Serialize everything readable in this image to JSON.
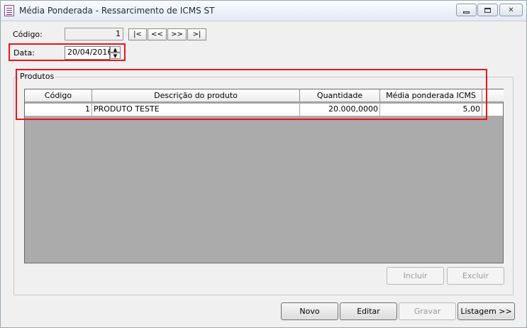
{
  "window": {
    "title": "Média Ponderada - Ressarcimento de ICMS ST",
    "icons": {
      "app": "form-icon",
      "minimize": "minimize-icon",
      "maximize": "maximize-icon",
      "close": "close-icon"
    },
    "close_glyph": "✕"
  },
  "form": {
    "codigo_label": "Código:",
    "codigo_value": "1",
    "data_label": "Data:",
    "data_value": "20/04/2016",
    "spin_up": "▲",
    "spin_down": "▼"
  },
  "navigation": {
    "first": "|<",
    "prev": "<<",
    "next": ">>",
    "last": ">|"
  },
  "produtos": {
    "caption": "Produtos",
    "columns": [
      "Código",
      "Descrição do produto",
      "Quantidade",
      "Média ponderada ICMS ST"
    ],
    "rows": [
      {
        "codigo": "1",
        "descricao": "PRODUTO TESTE",
        "quantidade": "20.000,0000",
        "media": "5,00"
      }
    ],
    "incluir": "Incluir",
    "excluir": "Excluir"
  },
  "buttons": {
    "novo": "Novo",
    "editar": "Editar",
    "gravar": "Gravar",
    "listagem": "Listagem >>"
  },
  "colors": {
    "highlight": "#e8161b"
  }
}
